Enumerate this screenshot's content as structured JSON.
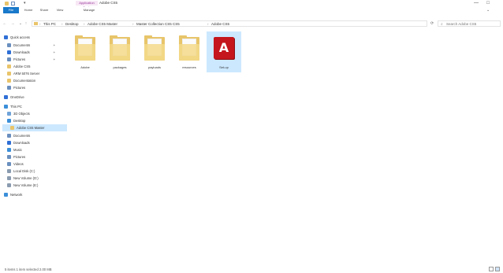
{
  "title_bar": {
    "context_tab_group": "Application Tools",
    "window_title": "Adobe CS5",
    "minimize_glyph": "—",
    "maximize_glyph": "□"
  },
  "ribbon": {
    "tabs": [
      {
        "label": "File"
      },
      {
        "label": "Home"
      },
      {
        "label": "Share"
      },
      {
        "label": "View"
      },
      {
        "label": "Manage"
      }
    ]
  },
  "address_bar": {
    "breadcrumbs": [
      "This PC",
      "Desktop",
      "Adobe CS5 Master",
      "Master Collection CS5 CS5",
      "Adobe CS5"
    ],
    "separator": "›"
  },
  "search": {
    "placeholder": "Search Adobe CS5"
  },
  "nav_pane": {
    "items": [
      {
        "label": "Quick access",
        "icon": "star-icon",
        "color": "#2f6fd6",
        "indent": 0,
        "pinned": false,
        "selected": false
      },
      {
        "label": "Documents",
        "icon": "documents-icon",
        "color": "#6a8fbf",
        "indent": 1,
        "pinned": true,
        "selected": false
      },
      {
        "label": "Downloads",
        "icon": "download-icon",
        "color": "#2f6fd6",
        "indent": 1,
        "pinned": true,
        "selected": false
      },
      {
        "label": "Pictures",
        "icon": "pictures-icon",
        "color": "#6a8fbf",
        "indent": 1,
        "pinned": true,
        "selected": false
      },
      {
        "label": "Adobe CS5",
        "icon": "folder-icon",
        "color": "#e9c46a",
        "indent": 1,
        "pinned": false,
        "selected": false
      },
      {
        "label": "ARM 5076 Server",
        "icon": "folder-icon",
        "color": "#e9c46a",
        "indent": 1,
        "pinned": false,
        "selected": false
      },
      {
        "label": "Documentation",
        "icon": "folder-icon",
        "color": "#e9c46a",
        "indent": 1,
        "pinned": false,
        "selected": false
      },
      {
        "label": "Pictures",
        "icon": "pictures-icon",
        "color": "#6a8fbf",
        "indent": 1,
        "pinned": false,
        "selected": false
      },
      {
        "label": "OneDrive",
        "icon": "cloud-icon",
        "color": "#2f6fd6",
        "indent": 0,
        "pinned": false,
        "selected": false
      },
      {
        "label": "This PC",
        "icon": "computer-icon",
        "color": "#3b8fd9",
        "indent": 0,
        "pinned": false,
        "selected": false
      },
      {
        "label": "3D Objects",
        "icon": "cube-icon",
        "color": "#6fa3d8",
        "indent": 1,
        "pinned": false,
        "selected": false
      },
      {
        "label": "Desktop",
        "icon": "desktop-icon",
        "color": "#3b8fd9",
        "indent": 1,
        "pinned": false,
        "selected": false
      },
      {
        "label": "Adobe CS5 Master",
        "icon": "folder-icon",
        "color": "#e9c46a",
        "indent": 2,
        "pinned": false,
        "selected": true
      },
      {
        "label": "Documents",
        "icon": "documents-icon",
        "color": "#6a8fbf",
        "indent": 1,
        "pinned": false,
        "selected": false
      },
      {
        "label": "Downloads",
        "icon": "download-icon",
        "color": "#2f6fd6",
        "indent": 1,
        "pinned": false,
        "selected": false
      },
      {
        "label": "Music",
        "icon": "music-icon",
        "color": "#3b8fd9",
        "indent": 1,
        "pinned": false,
        "selected": false
      },
      {
        "label": "Pictures",
        "icon": "pictures-icon",
        "color": "#6a8fbf",
        "indent": 1,
        "pinned": false,
        "selected": false
      },
      {
        "label": "Videos",
        "icon": "video-icon",
        "color": "#6a8fbf",
        "indent": 1,
        "pinned": false,
        "selected": false
      },
      {
        "label": "Local Disk (C:)",
        "icon": "drive-icon",
        "color": "#8a9bb0",
        "indent": 1,
        "pinned": false,
        "selected": false
      },
      {
        "label": "New Volume (D:)",
        "icon": "drive-icon",
        "color": "#8a9bb0",
        "indent": 1,
        "pinned": false,
        "selected": false
      },
      {
        "label": "New Volume (E:)",
        "icon": "drive-icon",
        "color": "#8a9bb0",
        "indent": 1,
        "pinned": false,
        "selected": false
      },
      {
        "label": "Network",
        "icon": "network-icon",
        "color": "#3b8fd9",
        "indent": 0,
        "pinned": false,
        "selected": false
      }
    ]
  },
  "content": {
    "items": [
      {
        "name": "Adobe",
        "type": "folder",
        "selected": false
      },
      {
        "name": "packages",
        "type": "folder",
        "selected": false
      },
      {
        "name": "payloads",
        "type": "folder",
        "selected": false
      },
      {
        "name": "resources",
        "type": "folder",
        "selected": false
      },
      {
        "name": "Set-up",
        "type": "adobe-application",
        "selected": true
      }
    ]
  },
  "status_bar": {
    "text": "5 items    1 item selected 2.00 MB"
  }
}
